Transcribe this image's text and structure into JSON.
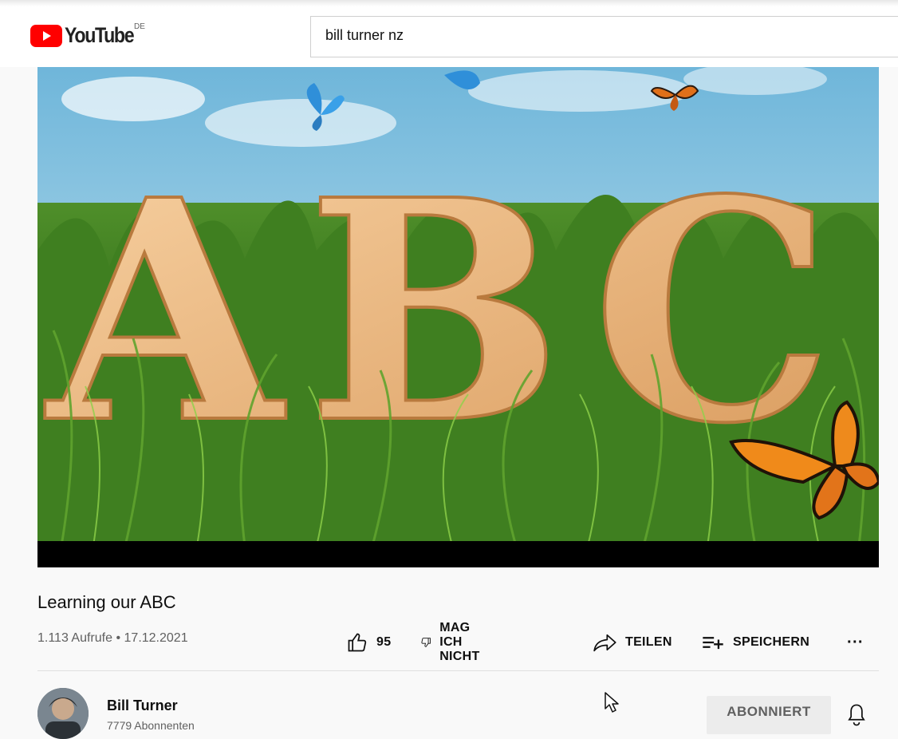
{
  "header": {
    "logo_text": "YouTube",
    "region_code": "DE",
    "search_value": "bill turner nz"
  },
  "video": {
    "thumbnail_text": "ABC",
    "title": "Learning our ABC",
    "views": "1.113 Aufrufe",
    "separator": "•",
    "date": "17.12.2021"
  },
  "actions": {
    "like_count": "95",
    "dislike_label": "MAG ICH NICHT",
    "share_label": "TEILEN",
    "save_label": "SPEICHERN",
    "more_label": "···"
  },
  "channel": {
    "name": "Bill Turner",
    "subscribers": "7779 Abonnenten",
    "subscribe_label": "ABONNIERT"
  },
  "icons": {
    "logo": "youtube-play-icon",
    "like": "thumbs-up-icon",
    "dislike": "thumbs-down-icon",
    "share": "share-arrow-icon",
    "save": "playlist-add-icon",
    "bell": "bell-icon",
    "cursor": "mouse-pointer-icon"
  },
  "colors": {
    "brand_red": "#ff0000",
    "subscribed_button_bg": "#ececec",
    "text_secondary": "#606060"
  }
}
